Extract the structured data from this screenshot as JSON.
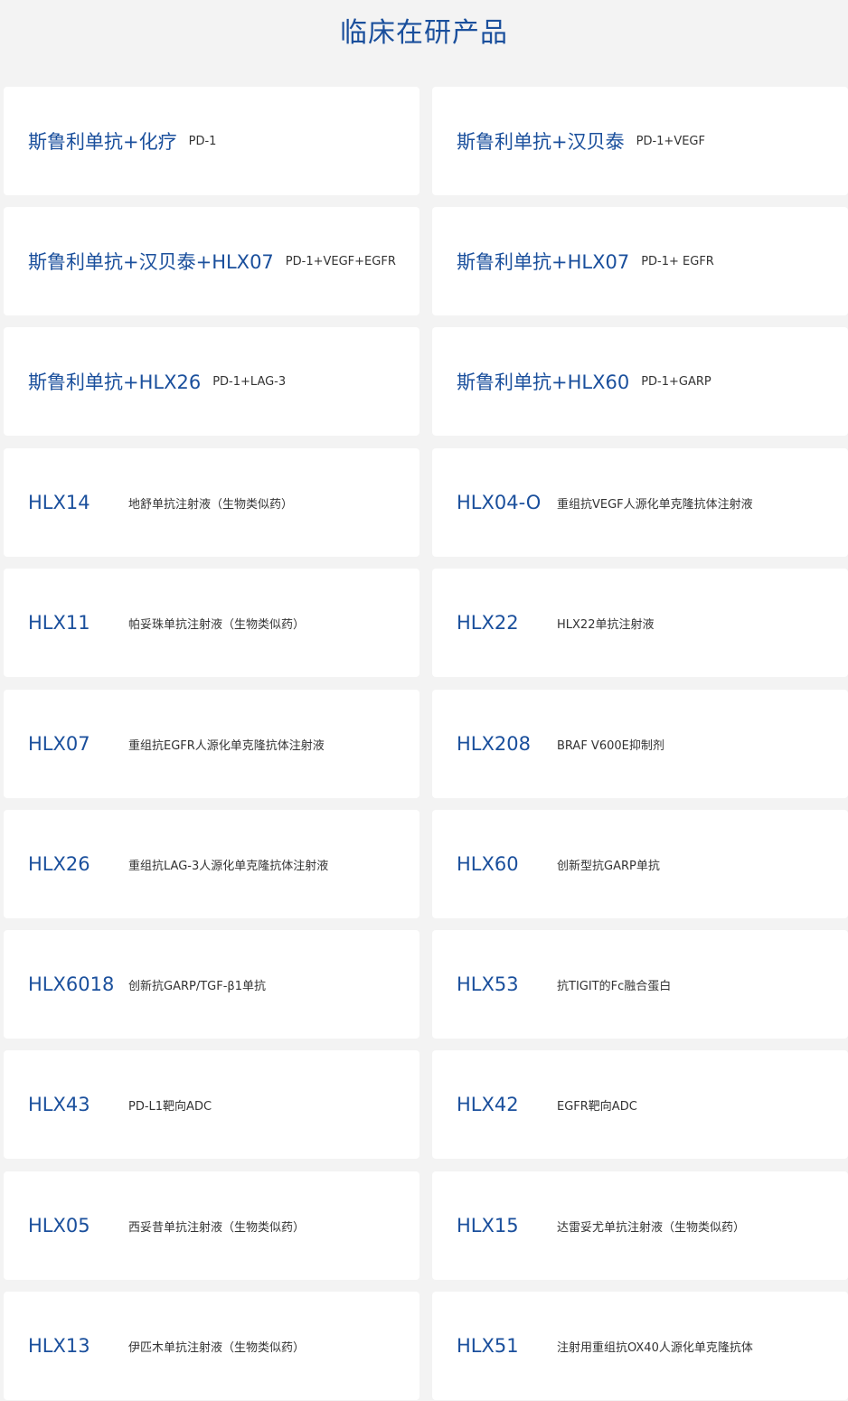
{
  "title": "临床在研产品",
  "products": [
    {
      "name": "斯鲁利单抗+化疗",
      "desc": "PD-1"
    },
    {
      "name": "斯鲁利单抗+汉贝泰",
      "desc": "PD-1+VEGF"
    },
    {
      "name": "斯鲁利单抗+汉贝泰+HLX07",
      "desc": "PD-1+VEGF+EGFR"
    },
    {
      "name": "斯鲁利单抗+HLX07",
      "desc": "PD-1+ EGFR"
    },
    {
      "name": "斯鲁利单抗+HLX26",
      "desc": "PD-1+LAG-3"
    },
    {
      "name": "斯鲁利单抗+HLX60",
      "desc": "PD-1+GARP"
    },
    {
      "name": "HLX14",
      "desc": "地舒单抗注射液（生物类似药）"
    },
    {
      "name": "HLX04-O",
      "desc": "重组抗VEGF人源化单克隆抗体注射液"
    },
    {
      "name": "HLX11",
      "desc": "帕妥珠单抗注射液（生物类似药）"
    },
    {
      "name": "HLX22",
      "desc": "HLX22单抗注射液"
    },
    {
      "name": "HLX07",
      "desc": "重组抗EGFR人源化单克隆抗体注射液"
    },
    {
      "name": "HLX208",
      "desc": "BRAF V600E抑制剂"
    },
    {
      "name": "HLX26",
      "desc": "重组抗LAG-3人源化单克隆抗体注射液"
    },
    {
      "name": "HLX60",
      "desc": "创新型抗GARP单抗"
    },
    {
      "name": "HLX6018",
      "desc": "创新抗GARP/TGF-β1单抗"
    },
    {
      "name": "HLX53",
      "desc": "抗TIGIT的Fc融合蛋白"
    },
    {
      "name": "HLX43",
      "desc": "PD-L1靶向ADC"
    },
    {
      "name": "HLX42",
      "desc": "EGFR靶向ADC"
    },
    {
      "name": "HLX05",
      "desc": "西妥昔单抗注射液（生物类似药）"
    },
    {
      "name": "HLX15",
      "desc": "达雷妥尤单抗注射液（生物类似药）"
    },
    {
      "name": "HLX13",
      "desc": "伊匹木单抗注射液（生物类似药）"
    },
    {
      "name": "HLX51",
      "desc": "注射用重组抗OX40人源化单克隆抗体"
    }
  ]
}
